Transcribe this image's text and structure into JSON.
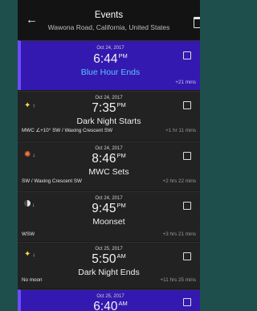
{
  "header": {
    "back_icon": "arrow-left-icon",
    "title": "Events",
    "subtitle": "Wawona Road, California, United States",
    "calendar_icon": "calendar-icon"
  },
  "events": [
    {
      "date": "Oct 24, 2017",
      "time": "6:44",
      "ampm": "PM",
      "name": "Blue Hour Ends",
      "left_note": "",
      "right_note": "+21 mins",
      "icon": "",
      "highlight": true
    },
    {
      "date": "Oct 24, 2017",
      "time": "7:35",
      "ampm": "PM",
      "name": "Dark Night Starts",
      "left_note": "MWC ∠+10° SW / Waxing Crescent SW",
      "right_note": "+1 hr 11 mins",
      "icon": "star-up-icon",
      "highlight": false
    },
    {
      "date": "Oct 24, 2017",
      "time": "8:46",
      "ampm": "PM",
      "name": "MWC Sets",
      "left_note": "SW / Waxing Crescent SW",
      "right_note": "+2 hrs 22 mins",
      "icon": "milky-way-down-icon",
      "highlight": false
    },
    {
      "date": "Oct 24, 2017",
      "time": "9:45",
      "ampm": "PM",
      "name": "Moonset",
      "left_note": "WSW",
      "right_note": "+3 hrs 21 mins",
      "icon": "moon-down-icon",
      "highlight": false
    },
    {
      "date": "Oct 25, 2017",
      "time": "5:50",
      "ampm": "AM",
      "name": "Dark Night Ends",
      "left_note": "No moon",
      "right_note": "+11 hrs 25 mins",
      "icon": "star-down-icon",
      "highlight": false
    },
    {
      "date": "Oct 25, 2017",
      "time": "6:40",
      "ampm": "AM",
      "name": "",
      "left_note": "",
      "right_note": "",
      "icon": "",
      "highlight": true
    }
  ]
}
